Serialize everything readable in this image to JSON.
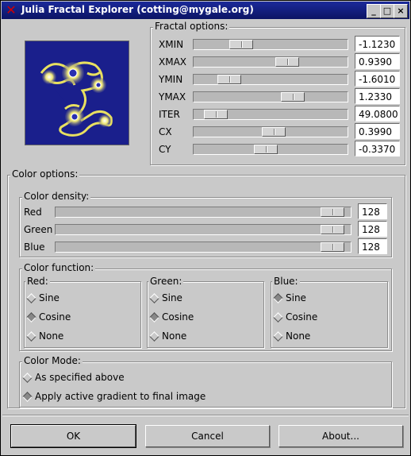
{
  "window": {
    "title": "Julia Fractal Explorer (cotting@mygale.org)"
  },
  "fractal_options": {
    "label": "Fractal options:",
    "rows": [
      {
        "label": "XMIN",
        "value": "-1.1230",
        "slider_fraction": 0.27
      },
      {
        "label": "XMAX",
        "value": "0.9390",
        "slider_fraction": 0.62
      },
      {
        "label": "YMIN",
        "value": "-1.6010",
        "slider_fraction": 0.18
      },
      {
        "label": "YMAX",
        "value": "1.2330",
        "slider_fraction": 0.66
      },
      {
        "label": "ITER",
        "value": "49.0800",
        "slider_fraction": 0.08
      },
      {
        "label": "CX",
        "value": "0.3990",
        "slider_fraction": 0.52
      },
      {
        "label": "CY",
        "value": "-0.3370",
        "slider_fraction": 0.46
      }
    ]
  },
  "color_options": {
    "label": "Color options:",
    "density": {
      "label": "Color density:",
      "rows": [
        {
          "label": "Red",
          "value": "128",
          "slider_fraction": 0.97
        },
        {
          "label": "Green",
          "value": "128",
          "slider_fraction": 0.97
        },
        {
          "label": "Blue",
          "value": "128",
          "slider_fraction": 0.97
        }
      ]
    },
    "function": {
      "label": "Color function:",
      "groups": [
        {
          "label": "Red:",
          "options": [
            "Sine",
            "Cosine",
            "None"
          ],
          "selected": 1
        },
        {
          "label": "Green:",
          "options": [
            "Sine",
            "Cosine",
            "None"
          ],
          "selected": 1
        },
        {
          "label": "Blue:",
          "options": [
            "Sine",
            "Cosine",
            "None"
          ],
          "selected": 0
        }
      ]
    },
    "mode": {
      "label": "Color Mode:",
      "options": [
        "As specified above",
        "Apply active gradient to final image"
      ],
      "selected": 1
    }
  },
  "buttons": {
    "ok": "OK",
    "cancel": "Cancel",
    "about": "About..."
  },
  "titlebar_buttons": {
    "minimize": "_",
    "maximize": "□",
    "close": "×"
  },
  "colors": {
    "titlebar": "#0b1464",
    "window_bg": "#c9c9c9",
    "fractal_bg": "#1a1f8c",
    "fractal_edge": "#e8e060"
  }
}
